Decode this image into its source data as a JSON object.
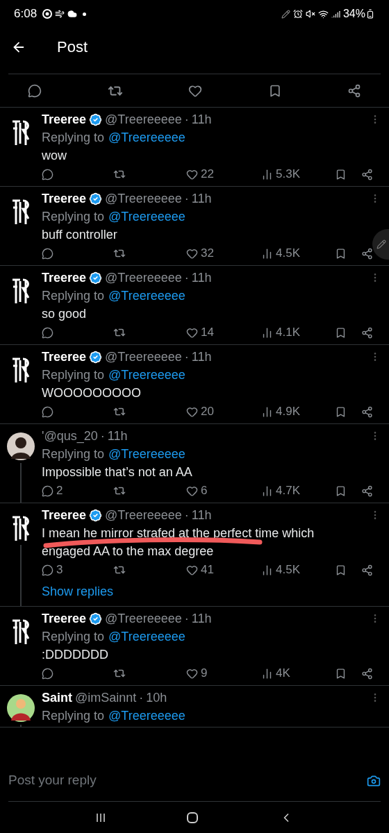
{
  "status_bar": {
    "time": "6:08",
    "battery": "34%"
  },
  "header": {
    "title": "Post"
  },
  "reply_field": {
    "placeholder": "Post your reply"
  },
  "replies": [
    {
      "avatar": {
        "kind": "logo"
      },
      "name": "Treeree",
      "verified": true,
      "handle": "@Treereeeee",
      "separator": "·",
      "time": "11h",
      "replying_label": "Replying to",
      "replying_to": "@Treereeeee",
      "text": "wow",
      "likes": "22",
      "views": "5.3K",
      "threaded": false
    },
    {
      "avatar": {
        "kind": "logo"
      },
      "name": "Treeree",
      "verified": true,
      "handle": "@Treereeeee",
      "separator": "·",
      "time": "11h",
      "replying_label": "Replying to",
      "replying_to": "@Treereeeee",
      "text": "buff controller",
      "likes": "32",
      "views": "4.5K",
      "threaded": false
    },
    {
      "avatar": {
        "kind": "logo"
      },
      "name": "Treeree",
      "verified": true,
      "handle": "@Treereeeee",
      "separator": "·",
      "time": "11h",
      "replying_label": "Replying to",
      "replying_to": "@Treereeeee",
      "text": "so good",
      "likes": "14",
      "views": "4.1K",
      "threaded": false
    },
    {
      "avatar": {
        "kind": "logo"
      },
      "name": "Treeree",
      "verified": true,
      "handle": "@Treereeeee",
      "separator": "·",
      "time": "11h",
      "replying_label": "Replying to",
      "replying_to": "@Treereeeee",
      "text": "WOOOOOOOOO",
      "likes": "20",
      "views": "4.9K",
      "threaded": false
    },
    {
      "avatar": {
        "kind": "photo"
      },
      "verified": false,
      "handle": "'@qus_20",
      "separator": "·",
      "time": "11h",
      "replying_label": "Replying to",
      "replying_to": "@Treereeeee",
      "text": "Impossible that’s not an AA",
      "replies": "2",
      "likes": "6",
      "views": "4.7K",
      "threaded": true
    },
    {
      "avatar": {
        "kind": "logo"
      },
      "name": "Treeree",
      "verified": true,
      "handle": "@Treereeeee",
      "separator": "·",
      "time": "11h",
      "text": "I mean he mirror strafed at the perfect time which engaged AA to the max degree",
      "scribbled": true,
      "replies": "3",
      "likes": "41",
      "views": "4.5K",
      "threaded": true,
      "show_replies": "Show replies"
    },
    {
      "avatar": {
        "kind": "logo"
      },
      "name": "Treeree",
      "verified": true,
      "handle": "@Treereeeee",
      "separator": "·",
      "time": "11h",
      "replying_label": "Replying to",
      "replying_to": "@Treereeeee",
      "text": ":DDDDDDD",
      "likes": "9",
      "views": "4K",
      "threaded": false
    },
    {
      "avatar": {
        "kind": "cartoon"
      },
      "name": "Saint",
      "verified": false,
      "handle": "@imSainnt",
      "separator": "·",
      "time": "10h",
      "replying_label": "Replying to",
      "replying_to": "@Treereeeee",
      "threaded": true
    }
  ]
}
